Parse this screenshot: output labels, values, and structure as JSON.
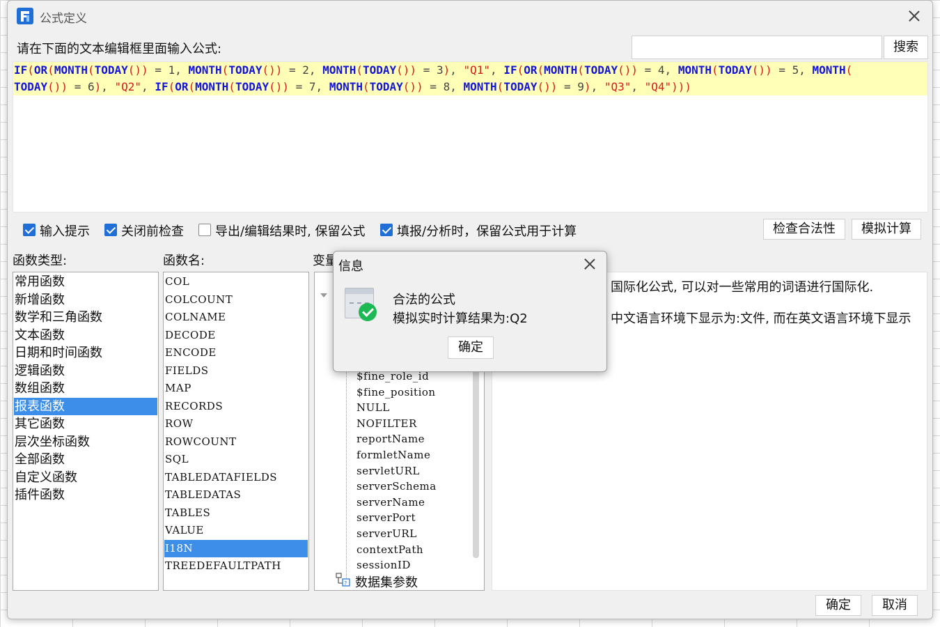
{
  "window": {
    "title": "公式定义"
  },
  "prompt": "请在下面的文本编辑框里面输入公式:",
  "search": {
    "value": "",
    "button": "搜索"
  },
  "formula": {
    "line1": [
      {
        "t": "IF",
        "k": "fn"
      },
      {
        "t": "(",
        "k": "p"
      },
      {
        "t": "OR",
        "k": "fn"
      },
      {
        "t": "(",
        "k": "p"
      },
      {
        "t": "MONTH",
        "k": "fn"
      },
      {
        "t": "(",
        "k": "p"
      },
      {
        "t": "TODAY",
        "k": "fn"
      },
      {
        "t": "())",
        "k": "p"
      },
      {
        "t": " = 1, ",
        "k": "op"
      },
      {
        "t": "MONTH",
        "k": "fn"
      },
      {
        "t": "(",
        "k": "p"
      },
      {
        "t": "TODAY",
        "k": "fn"
      },
      {
        "t": "())",
        "k": "p"
      },
      {
        "t": " = 2, ",
        "k": "op"
      },
      {
        "t": "MONTH",
        "k": "fn"
      },
      {
        "t": "(",
        "k": "p"
      },
      {
        "t": "TODAY",
        "k": "fn"
      },
      {
        "t": "())",
        "k": "p"
      },
      {
        "t": " = 3",
        "k": "op"
      },
      {
        "t": ")",
        "k": "p"
      },
      {
        "t": ", ",
        "k": "op"
      },
      {
        "t": "\"Q1\"",
        "k": "str"
      },
      {
        "t": ", ",
        "k": "op"
      },
      {
        "t": "IF",
        "k": "fn"
      },
      {
        "t": "(",
        "k": "p"
      },
      {
        "t": "OR",
        "k": "fn"
      },
      {
        "t": "(",
        "k": "p"
      },
      {
        "t": "MONTH",
        "k": "fn"
      },
      {
        "t": "(",
        "k": "p"
      },
      {
        "t": "TODAY",
        "k": "fn"
      },
      {
        "t": "())",
        "k": "p"
      },
      {
        "t": " = 4, ",
        "k": "op"
      },
      {
        "t": "MONTH",
        "k": "fn"
      },
      {
        "t": "(",
        "k": "p"
      },
      {
        "t": "TODAY",
        "k": "fn"
      },
      {
        "t": "())",
        "k": "p"
      },
      {
        "t": " = 5, ",
        "k": "op"
      },
      {
        "t": "MONTH",
        "k": "fn"
      },
      {
        "t": "(",
        "k": "p"
      }
    ],
    "line2": [
      {
        "t": "TODAY",
        "k": "fn"
      },
      {
        "t": "())",
        "k": "p"
      },
      {
        "t": " = 6",
        "k": "op"
      },
      {
        "t": ")",
        "k": "p"
      },
      {
        "t": ", ",
        "k": "op"
      },
      {
        "t": "\"Q2\"",
        "k": "str"
      },
      {
        "t": ", ",
        "k": "op"
      },
      {
        "t": "IF",
        "k": "fn"
      },
      {
        "t": "(",
        "k": "p"
      },
      {
        "t": "OR",
        "k": "fn"
      },
      {
        "t": "(",
        "k": "p"
      },
      {
        "t": "MONTH",
        "k": "fn"
      },
      {
        "t": "(",
        "k": "p"
      },
      {
        "t": "TODAY",
        "k": "fn"
      },
      {
        "t": "())",
        "k": "p"
      },
      {
        "t": " = 7, ",
        "k": "op"
      },
      {
        "t": "MONTH",
        "k": "fn"
      },
      {
        "t": "(",
        "k": "p"
      },
      {
        "t": "TODAY",
        "k": "fn"
      },
      {
        "t": "())",
        "k": "p"
      },
      {
        "t": " = 8, ",
        "k": "op"
      },
      {
        "t": "MONTH",
        "k": "fn"
      },
      {
        "t": "(",
        "k": "p"
      },
      {
        "t": "TODAY",
        "k": "fn"
      },
      {
        "t": "())",
        "k": "p"
      },
      {
        "t": " = 9",
        "k": "op"
      },
      {
        "t": ")",
        "k": "p"
      },
      {
        "t": ", ",
        "k": "op"
      },
      {
        "t": "\"Q3\"",
        "k": "str"
      },
      {
        "t": ", ",
        "k": "op"
      },
      {
        "t": "\"Q4\"",
        "k": "str"
      },
      {
        "t": ")))",
        "k": "p"
      }
    ]
  },
  "options": [
    {
      "label": "输入提示",
      "checked": true
    },
    {
      "label": "关闭前检查",
      "checked": true
    },
    {
      "label": "导出/编辑结果时, 保留公式",
      "checked": false
    },
    {
      "label": "填报/分析时，保留公式用于计算",
      "checked": true
    }
  ],
  "actions": {
    "check": "检查合法性",
    "simulate": "模拟计算"
  },
  "categories": {
    "label": "函数类型:",
    "items": [
      "常用函数",
      "新增函数",
      "数学和三角函数",
      "文本函数",
      "日期和时间函数",
      "逻辑函数",
      "数组函数",
      "报表函数",
      "其它函数",
      "层次坐标函数",
      "全部函数",
      "自定义函数",
      "插件函数"
    ],
    "selected": 7
  },
  "functions": {
    "label": "函数名:",
    "items": [
      "COL",
      "COLCOUNT",
      "COLNAME",
      "DECODE",
      "ENCODE",
      "FIELDS",
      "MAP",
      "RECORDS",
      "ROW",
      "ROWCOUNT",
      "SQL",
      "TABLEDATAFIELDS",
      "TABLEDATAS",
      "TABLES",
      "VALUE",
      "I18N",
      "TREEDEFAULTPATH"
    ],
    "selected": 15
  },
  "variables": {
    "label": "变量",
    "items": [
      "$fine_role_id",
      "$fine_position",
      "NULL",
      "NOFILTER",
      "reportName",
      "formletName",
      "servletURL",
      "serverSchema",
      "serverName",
      "serverPort",
      "serverURL",
      "contextPath",
      "sessionID"
    ],
    "dataset": "数据集参数"
  },
  "description": {
    "line1": "国际化公式, 可以对一些常用的词语进行国际化.",
    "line2": "中文语言环境下显示为:文件, 而在英文语言环境下显示"
  },
  "footer": {
    "ok": "确定",
    "cancel": "取消"
  },
  "dialog": {
    "title": "信息",
    "line1": "合法的公式",
    "line2": "模拟实时计算结果为:Q2",
    "ok": "确定"
  }
}
